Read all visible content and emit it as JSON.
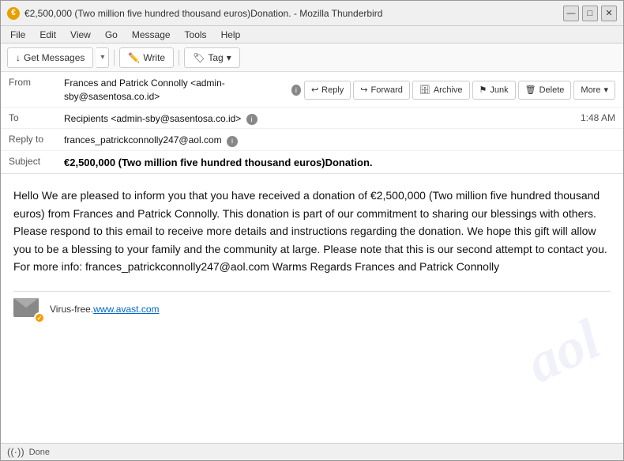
{
  "window": {
    "title": "€2,500,000 (Two million five hundred thousand euros)Donation. - Mozilla Thunderbird",
    "icon": "€"
  },
  "title_controls": {
    "minimize": "—",
    "maximize": "□",
    "close": "✕"
  },
  "menu": {
    "items": [
      "File",
      "Edit",
      "View",
      "Go",
      "Message",
      "Tools",
      "Help"
    ]
  },
  "toolbar": {
    "get_messages_label": "Get Messages",
    "write_label": "Write",
    "tag_label": "Tag"
  },
  "action_buttons": {
    "reply_label": "Reply",
    "forward_label": "Forward",
    "archive_label": "Archive",
    "junk_label": "Junk",
    "delete_label": "Delete",
    "more_label": "More"
  },
  "email_header": {
    "from_label": "From",
    "from_value": "Frances and Patrick Connolly <admin-sby@sasentosa.co.id>",
    "to_label": "To",
    "to_value": "Recipients <admin-sby@sasentosa.co.id>",
    "time": "1:48 AM",
    "reply_to_label": "Reply to",
    "reply_to_value": "frances_patrickconnolly247@aol.com",
    "subject_label": "Subject",
    "subject_value": "€2,500,000 (Two million five hundred thousand euros)Donation."
  },
  "email_body": {
    "text": "Hello We are pleased to inform you that you have received a donation of €2,500,000 (Two million five hundred thousand euros) from Frances and Patrick Connolly. This donation is part of our commitment to sharing our blessings with others. Please respond to this email to receive more details and instructions regarding the donation. We hope this gift will allow you to be a blessing to your family and the community at large. Please note that this is our second attempt to contact you. For more info: frances_patrickconnolly247@aol.com Warms Regards Frances and Patrick Connolly"
  },
  "virus_footer": {
    "text": "Virus-free.",
    "link_text": "www.avast.com",
    "link_url": "www.avast.com"
  },
  "status_bar": {
    "status": "Done",
    "wifi_icon": "wifi-icon"
  },
  "watermark": {
    "text": "aol.com"
  }
}
